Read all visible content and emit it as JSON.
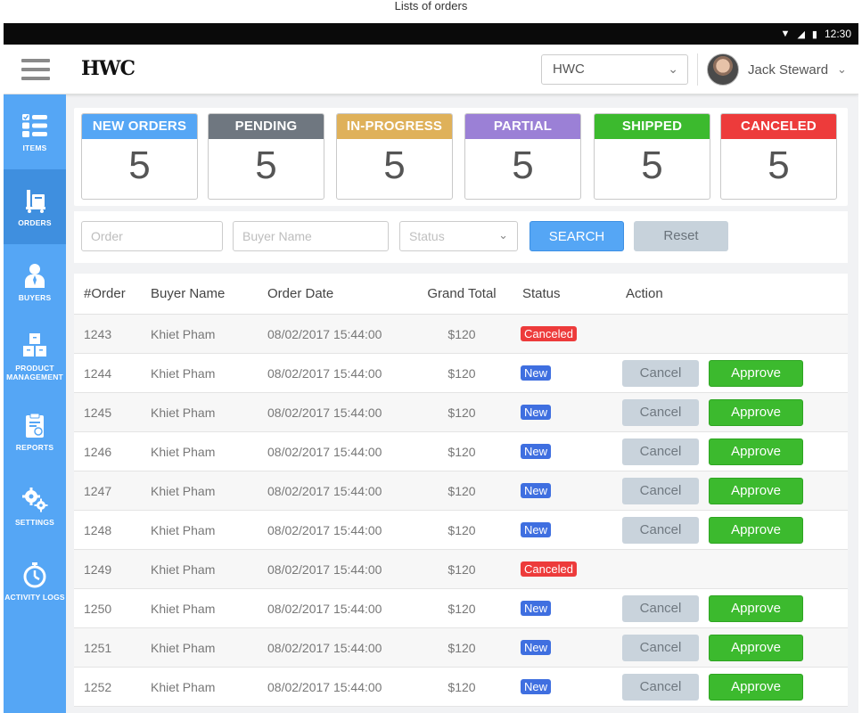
{
  "caption": "Lists of orders",
  "statusbar": {
    "time": "12:30"
  },
  "appbar": {
    "logo_text": "HWC",
    "logo_sub": "",
    "org_select_value": "HWC",
    "user_name": "Jack Steward"
  },
  "sidebar": {
    "items": [
      {
        "label": "ITEMS",
        "icon": "items-list-icon",
        "active": false
      },
      {
        "label": "ORDERS",
        "icon": "cart-icon",
        "active": true
      },
      {
        "label": "BUYERS",
        "icon": "person-icon",
        "active": false
      },
      {
        "label": "PRODUCT MANAGEMENT",
        "icon": "boxes-icon",
        "active": false
      },
      {
        "label": "REPORTS",
        "icon": "clipboard-icon",
        "active": false
      },
      {
        "label": "SETTINGS",
        "icon": "gears-icon",
        "active": false
      },
      {
        "label": "ACTIVITY LOGS",
        "icon": "stopwatch-icon",
        "active": false
      }
    ]
  },
  "summary": {
    "cards": [
      {
        "title": "NEW ORDERS",
        "count": "5",
        "color": "#55a6f5"
      },
      {
        "title": "PENDING",
        "count": "5",
        "color": "#6f7780"
      },
      {
        "title": "IN-PROGRESS",
        "count": "5",
        "color": "#dfb15a"
      },
      {
        "title": "PARTIAL",
        "count": "5",
        "color": "#9b80d6"
      },
      {
        "title": "SHIPPED",
        "count": "5",
        "color": "#3cba2e"
      },
      {
        "title": "CANCELED",
        "count": "5",
        "color": "#ed3b3b"
      }
    ]
  },
  "filters": {
    "order_placeholder": "Order",
    "buyer_placeholder": "Buyer Name",
    "status_placeholder": "Status",
    "search_label": "SEARCH",
    "reset_label": "Reset"
  },
  "table": {
    "headers": {
      "order": "#Order",
      "buyer": "Buyer Name",
      "date": "Order Date",
      "total": "Grand Total",
      "status": "Status",
      "action": "Action"
    },
    "cancel_label": "Cancel",
    "approve_label": "Approve",
    "rows": [
      {
        "order": "1243",
        "buyer": "Khiet Pham",
        "date": "08/02/2017  15:44:00",
        "total": "$120",
        "status": "Canceled"
      },
      {
        "order": "1244",
        "buyer": "Khiet Pham",
        "date": "08/02/2017  15:44:00",
        "total": "$120",
        "status": "New"
      },
      {
        "order": "1245",
        "buyer": "Khiet Pham",
        "date": "08/02/2017  15:44:00",
        "total": "$120",
        "status": "New"
      },
      {
        "order": "1246",
        "buyer": "Khiet Pham",
        "date": "08/02/2017  15:44:00",
        "total": "$120",
        "status": "New"
      },
      {
        "order": "1247",
        "buyer": "Khiet Pham",
        "date": "08/02/2017  15:44:00",
        "total": "$120",
        "status": "New"
      },
      {
        "order": "1248",
        "buyer": "Khiet Pham",
        "date": "08/02/2017  15:44:00",
        "total": "$120",
        "status": "New"
      },
      {
        "order": "1249",
        "buyer": "Khiet Pham",
        "date": "08/02/2017  15:44:00",
        "total": "$120",
        "status": "Canceled"
      },
      {
        "order": "1250",
        "buyer": "Khiet Pham",
        "date": "08/02/2017  15:44:00",
        "total": "$120",
        "status": "New"
      },
      {
        "order": "1251",
        "buyer": "Khiet Pham",
        "date": "08/02/2017  15:44:00",
        "total": "$120",
        "status": "New"
      },
      {
        "order": "1252",
        "buyer": "Khiet Pham",
        "date": "08/02/2017  15:44:00",
        "total": "$120",
        "status": "New"
      }
    ]
  }
}
